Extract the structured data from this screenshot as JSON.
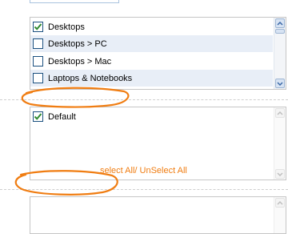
{
  "category_list": {
    "items": [
      {
        "label": "Desktops",
        "checked": true
      },
      {
        "label": "Desktops > PC",
        "checked": false
      },
      {
        "label": "Desktops > Mac",
        "checked": false
      },
      {
        "label": "Laptops & Notebooks",
        "checked": false
      }
    ]
  },
  "store_list": {
    "items": [
      {
        "label": "Default",
        "checked": true
      }
    ]
  },
  "annotation": {
    "text": "select All/ UnSelect All",
    "color": "#f07d12"
  },
  "colors": {
    "checkmark": "#2f8a2f",
    "checkbox_border": "#1c5180",
    "row_alt": "#e8eef7"
  }
}
